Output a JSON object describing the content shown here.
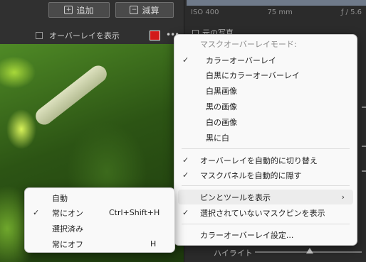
{
  "toolbar": {
    "add_label": "追加",
    "subtract_label": "減算"
  },
  "overlay": {
    "show_label": "オーバーレイを表示",
    "color": "#d21a1a",
    "more_label": "•••"
  },
  "right_panel": {
    "exif": [
      "ISO 400",
      "75 mm",
      "ƒ / 5.6"
    ],
    "original_label": "元の写真",
    "highlight_label": "ハイライト"
  },
  "main_menu": {
    "header": "マスクオーバーレイモード:",
    "mode_items": [
      {
        "label": "カラーオーバーレイ",
        "checked": true
      },
      {
        "label": "白黒にカラーオーバーレイ",
        "checked": false
      },
      {
        "label": "白黒画像",
        "checked": false
      },
      {
        "label": "黒の画像",
        "checked": false
      },
      {
        "label": "白の画像",
        "checked": false
      },
      {
        "label": "黒に白",
        "checked": false
      }
    ],
    "toggle_items": [
      {
        "label": "オーバーレイを自動的に切り替え",
        "checked": true
      },
      {
        "label": "マスクパネルを自動的に隠す",
        "checked": true
      }
    ],
    "pins_items": [
      {
        "label": "ピンとツールを表示",
        "checked": false,
        "submenu": true
      },
      {
        "label": "選択されていないマスクピンを表示",
        "checked": true
      }
    ],
    "settings_label": "カラーオーバーレイ設定..."
  },
  "sub_menu": {
    "items": [
      {
        "label": "自動",
        "checked": false,
        "shortcut": ""
      },
      {
        "label": "常にオン",
        "checked": true,
        "shortcut": "Ctrl+Shift+H"
      },
      {
        "label": "選択済み",
        "checked": false,
        "shortcut": ""
      },
      {
        "label": "常にオフ",
        "checked": false,
        "shortcut": "H"
      }
    ]
  }
}
